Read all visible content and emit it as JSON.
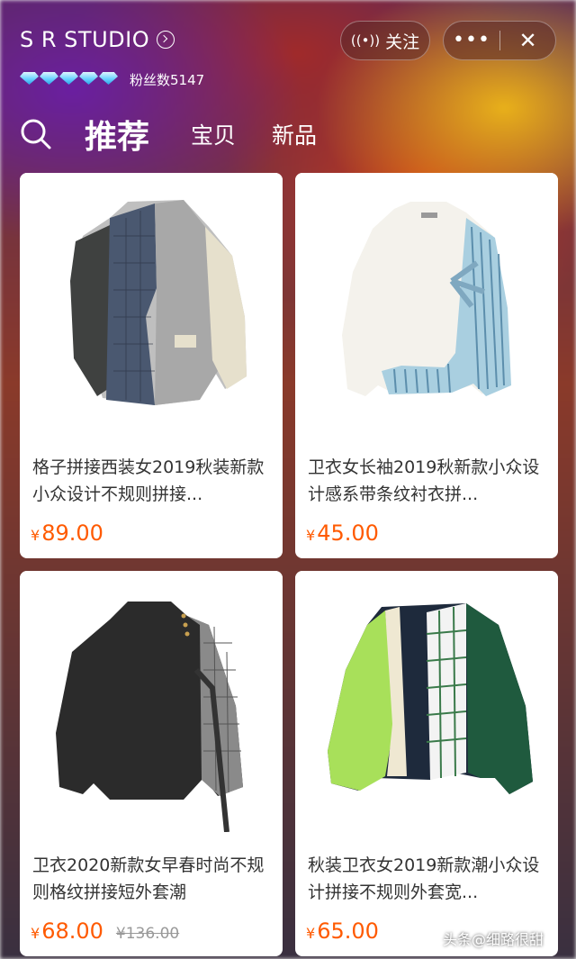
{
  "header": {
    "shop_name": "S R STUDIO",
    "fans_label": "粉丝数5147",
    "follow_label": "关注",
    "more_label": "•••",
    "close_label": "✕"
  },
  "tabs": [
    "推荐",
    "宝贝",
    "新品"
  ],
  "products": [
    {
      "title": "格子拼接西装女2019秋装新款小众设计不规则拼接...",
      "currency": "¥",
      "price": "89.00",
      "original_price": ""
    },
    {
      "title": "卫衣女长袖2019秋新款小众设计感系带条纹衬衣拼...",
      "currency": "¥",
      "price": "45.00",
      "original_price": ""
    },
    {
      "title": "卫衣2020新款女早春时尚不规则格纹拼接短外套潮",
      "currency": "¥",
      "price": "68.00",
      "original_price": "¥136.00"
    },
    {
      "title": "秋装卫衣女2019新款潮小众设计拼接不规则外套宽...",
      "currency": "¥",
      "price": "65.00",
      "original_price": ""
    }
  ],
  "watermark": "头条@细路很甜",
  "colors": {
    "price": "#ff5a00",
    "card_bg": "#ffffff",
    "page_bg": "#f2f2f2"
  },
  "icons": {
    "search": "search-icon",
    "follow": "radio-wave-icon",
    "more": "more-dots-icon",
    "close": "close-icon",
    "shop_link": "chevron-circle-icon",
    "rank": "diamond-icon"
  }
}
